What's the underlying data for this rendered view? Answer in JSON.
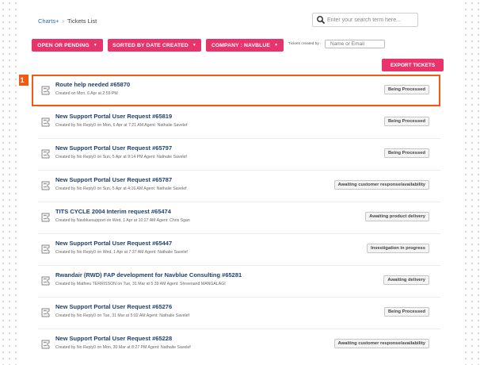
{
  "breadcrumb": {
    "parent": "Charts+",
    "current": "Tickets List"
  },
  "search": {
    "placeholder": "Enter your search term here..."
  },
  "filters": {
    "status_label": "OPEN OR PENDING",
    "sort_label": "SORTED BY DATE CREATED",
    "company_label": "COMPANY : NAVBLUE",
    "tickets_created_by_label": "Tickets created by",
    "tickets_created_by_placeholder": "Name or Email"
  },
  "actions": {
    "export_label": "EXPORT TICKETS"
  },
  "callout": {
    "number": "1"
  },
  "tickets": [
    {
      "title": "Route help needed #65870",
      "meta": "Created on Mon, 6 Apr at 2:59 PM",
      "status": "Being Processed"
    },
    {
      "title": "New Support Portal User Request #65819",
      "meta": "Created by No Reply0 on Mon, 6 Apr at 7:21 AM Agent: Nathalie Savelef",
      "status": "Being Processed"
    },
    {
      "title": "New Support Portal User Request #65797",
      "meta": "Created by No Reply0 on Sun, 5 Apr at 9:14 PM Agent: Nathalie Savelef",
      "status": "Being Processed"
    },
    {
      "title": "New Support Portal User Request #65787",
      "meta": "Created by No Reply0 on Sun, 5 Apr at 4:16 AM Agent: Nathalie Savelef",
      "status": "Awaiting customer response/availability"
    },
    {
      "title": "TITS CYCLE 2004 Interim request #65474",
      "meta": "Created by Navbluesupport on Wed, 1 Apr at 10:27 AM Agent: Chris Sgan",
      "status": "Awaiting product delivery"
    },
    {
      "title": "New Support Portal User Request #65447",
      "meta": "Created by No Reply0 on Wed, 1 Apr at 7:37 AM Agent: Nathalie Savelef",
      "status": "Investigation in progress"
    },
    {
      "title": "Rwandair (RWD) FAP development for Navblue Consulting #65281",
      "meta": "Created by Mathieu TERRISSON on Tue, 31 Mar at 5:39 AM Agent: Shreenand MANGALAGI",
      "status": "Awaiting delivery"
    },
    {
      "title": "New Support Portal User Request #65276",
      "meta": "Created by No Reply0 on Tue, 31 Mar at 5:02 AM Agent: Nathalie Savelef",
      "status": "Being Processed"
    },
    {
      "title": "New Support Portal User Request #65228",
      "meta": "Created by No Reply0 on Mon, 30 Mar at 8:27 PM Agent: Nathalie Savelef",
      "status": "Awaiting customer response/availability"
    }
  ]
}
